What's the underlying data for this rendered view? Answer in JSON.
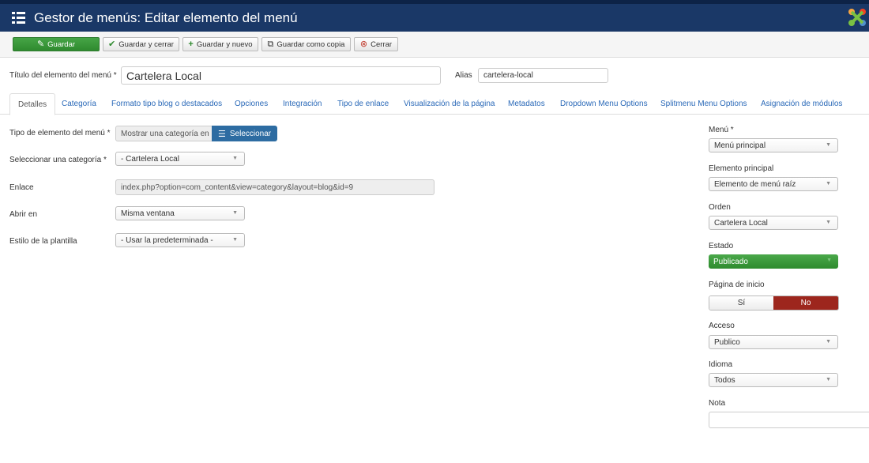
{
  "header": {
    "title": "Gestor de menús: Editar elemento del menú"
  },
  "toolbar": {
    "save": "Guardar",
    "save_close": "Guardar y cerrar",
    "save_new": "Guardar y nuevo",
    "save_copy": "Guardar como copia",
    "close": "Cerrar"
  },
  "form": {
    "title_label": "Título del elemento del menú *",
    "title_value": "Cartelera Local",
    "alias_label": "Alias",
    "alias_value": "cartelera-local"
  },
  "tabs": [
    "Detalles",
    "Categoría",
    "Formato tipo blog o destacados",
    "Opciones",
    "Integración",
    "Tipo de enlace",
    "Visualización de la página",
    "Metadatos",
    "Dropdown Menu Options",
    "Splitmenu Menu Options",
    "Asignación de módulos"
  ],
  "details": {
    "type_label": "Tipo de elemento del menú *",
    "type_value": "Mostrar una categoría en",
    "select_button": "Seleccionar",
    "category_label": "Seleccionar una categoría *",
    "category_value": "- Cartelera Local",
    "link_label": "Enlace",
    "link_value": "index.php?option=com_content&view=category&layout=blog&id=9",
    "open_label": "Abrir en",
    "open_value": "Misma ventana",
    "style_label": "Estilo de la plantilla",
    "style_value": "- Usar la predeterminada -"
  },
  "sidebar": {
    "menu_label": "Menú *",
    "menu_value": "Menú principal",
    "parent_label": "Elemento principal",
    "parent_value": "Elemento de menú raíz",
    "order_label": "Orden",
    "order_value": "Cartelera Local",
    "state_label": "Estado",
    "state_value": "Publicado",
    "home_label": "Página de inicio",
    "home_yes": "Sí",
    "home_no": "No",
    "access_label": "Acceso",
    "access_value": "Publico",
    "language_label": "Idioma",
    "language_value": "Todos",
    "note_label": "Nota",
    "note_value": ""
  },
  "colors": {
    "header": "#1a3867",
    "success": "#3a9a3a",
    "primary": "#2d6ca2",
    "danger": "#9d261d",
    "link": "#2a69b8"
  }
}
